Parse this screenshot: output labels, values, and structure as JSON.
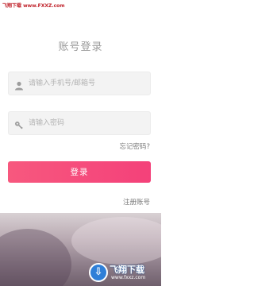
{
  "watermark_top": "飞翔下载 www.FXXZ.com",
  "login": {
    "title": "账号登录",
    "phone_placeholder": "请输入手机号/邮箱号",
    "password_placeholder": "请输入密码",
    "forgot_label": "忘记密码?",
    "login_button": "登录",
    "register_label": "注册账号"
  },
  "watermark_logo": {
    "title": "飞翔下载",
    "url": "www.fxxz.com"
  },
  "colors": {
    "accent": "#f4417a",
    "text_muted": "#9a9a9a"
  },
  "icons": {
    "phone_field": "user-icon",
    "password_field": "key-icon"
  }
}
